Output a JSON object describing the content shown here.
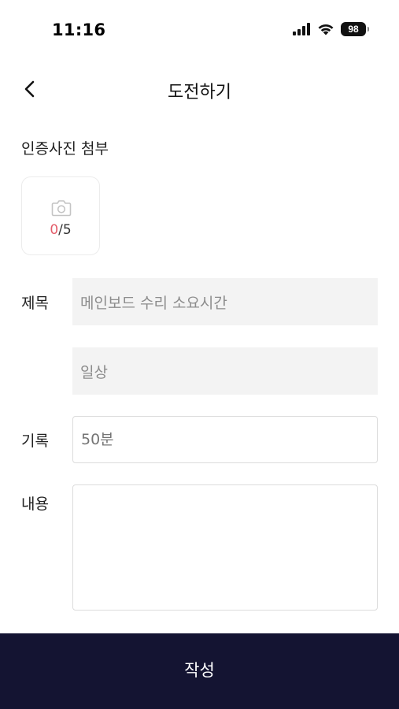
{
  "status_bar": {
    "time": "11:16",
    "battery": "98"
  },
  "header": {
    "title": "도전하기"
  },
  "photo_section": {
    "label": "인증사진 첨부",
    "current_count": "0",
    "max_count": "/5"
  },
  "form": {
    "title_label": "제목",
    "title_value": "메인보드 수리 소요시간",
    "category_value": "일상",
    "record_label": "기록",
    "record_placeholder": "50분",
    "content_label": "내용",
    "content_value": ""
  },
  "submit": {
    "label": "작성"
  },
  "colors": {
    "submit_background": "#141432",
    "count_accent": "#e35d6a",
    "filled_field": "#f3f3f3"
  },
  "icons": {
    "back": "chevron-left-icon",
    "camera": "camera-icon",
    "signal": "signal-icon",
    "wifi": "wifi-icon",
    "battery": "battery-icon"
  }
}
